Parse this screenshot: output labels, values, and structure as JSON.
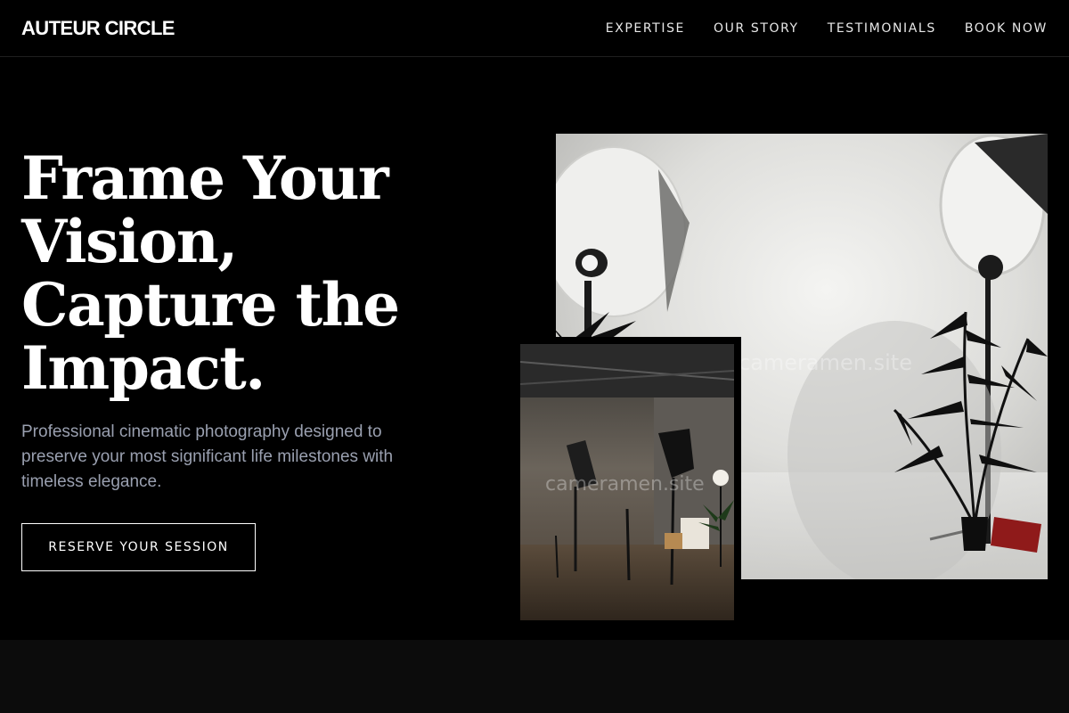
{
  "brand": {
    "name": "AUTEUR CIRCLE"
  },
  "nav": {
    "items": [
      {
        "label": "EXPERTISE"
      },
      {
        "label": "OUR STORY"
      },
      {
        "label": "TESTIMONIALS"
      },
      {
        "label": "BOOK NOW"
      }
    ]
  },
  "hero": {
    "headline_lines": [
      "Frame Your",
      "Vision,",
      "Capture the",
      "Impact."
    ],
    "subcopy": "Professional cinematic photography designed to preserve your most significant life milestones with timeless elegance.",
    "cta_label": "RESERVE YOUR SESSION"
  },
  "images": {
    "main": {
      "watermark": "cameramen.site"
    },
    "inset": {
      "watermark": "cameramen.site"
    }
  },
  "colors": {
    "background": "#000000",
    "text": "#ffffff",
    "muted_text": "#9aa0b0",
    "nav_text": "#e8e8e8",
    "section_below": "#0c0c0c"
  }
}
